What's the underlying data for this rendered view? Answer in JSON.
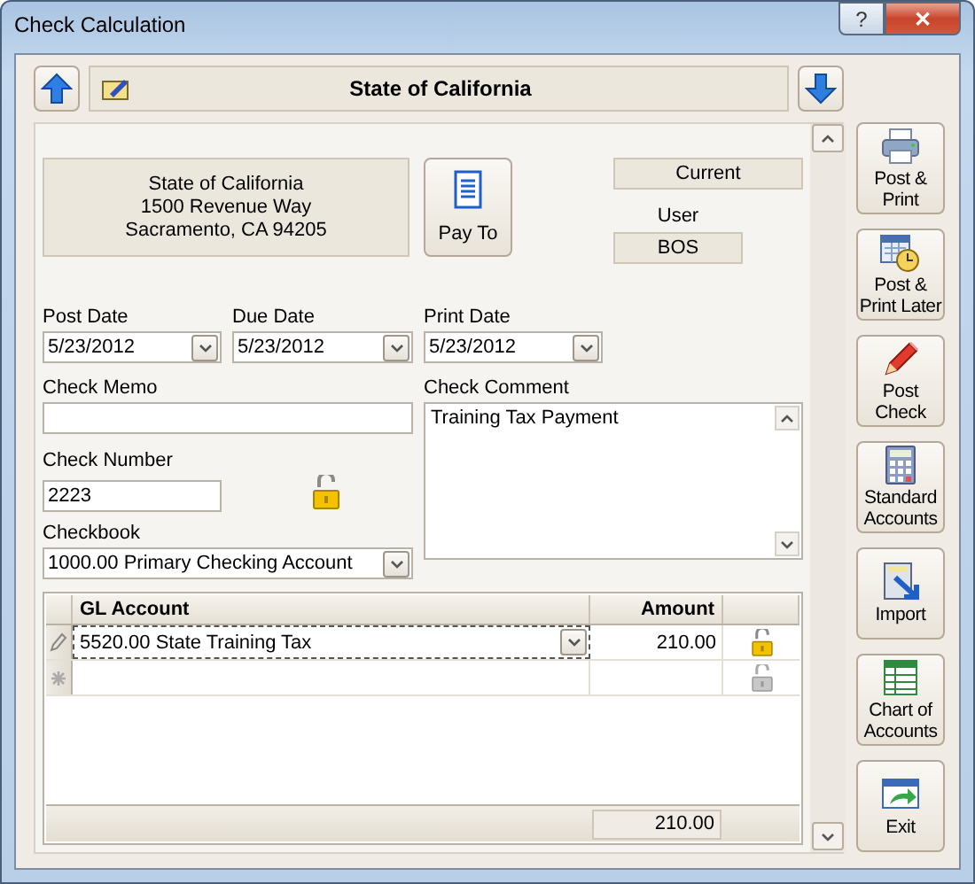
{
  "window": {
    "title": "Check Calculation",
    "buttons": [
      {
        "kind": "help",
        "label": "?"
      },
      {
        "kind": "close",
        "label": "✕"
      }
    ]
  },
  "navigator": {
    "payee": "State of California"
  },
  "payee_address": [
    "State of California",
    "1500 Revenue Way",
    "Sacramento, CA 94205"
  ],
  "pay_to_button": "Pay To",
  "status": "Current",
  "user": {
    "label": "User",
    "value": "BOS"
  },
  "dates": [
    {
      "label": "Post Date",
      "value": "5/23/2012"
    },
    {
      "label": "Due Date",
      "value": "5/23/2012"
    },
    {
      "label": "Print Date",
      "value": "5/23/2012"
    }
  ],
  "check_memo": {
    "label": "Check Memo"
  },
  "check_number": {
    "label": "Check Number",
    "value": "2223",
    "locked": false
  },
  "checkbook": {
    "label": "Checkbook",
    "value": "1000.00  Primary Checking Account"
  },
  "check_comment": {
    "label": "Check Comment",
    "value": "Training Tax Payment"
  },
  "gl_table": {
    "columns": [
      "GL Account",
      "Amount"
    ],
    "rows": [
      {
        "kind": "editing",
        "account": "5520.00  State Training Tax",
        "amount": "210.00",
        "locked": false,
        "disabled": false
      },
      {
        "kind": "new",
        "locked": false,
        "disabled": true
      }
    ],
    "total": "210.00"
  },
  "actions": [
    {
      "kind": "printer",
      "label": "Post &\nPrint"
    },
    {
      "kind": "calendar",
      "label": "Post &\nPrint Later"
    },
    {
      "kind": "pencil",
      "label": "Post\nCheck"
    },
    {
      "kind": "calculator",
      "label": "Standard\nAccounts"
    },
    {
      "kind": "import",
      "label": "Import"
    },
    {
      "kind": "grid",
      "label": "Chart of\nAccounts"
    },
    {
      "kind": "exit",
      "label": "Exit"
    }
  ]
}
